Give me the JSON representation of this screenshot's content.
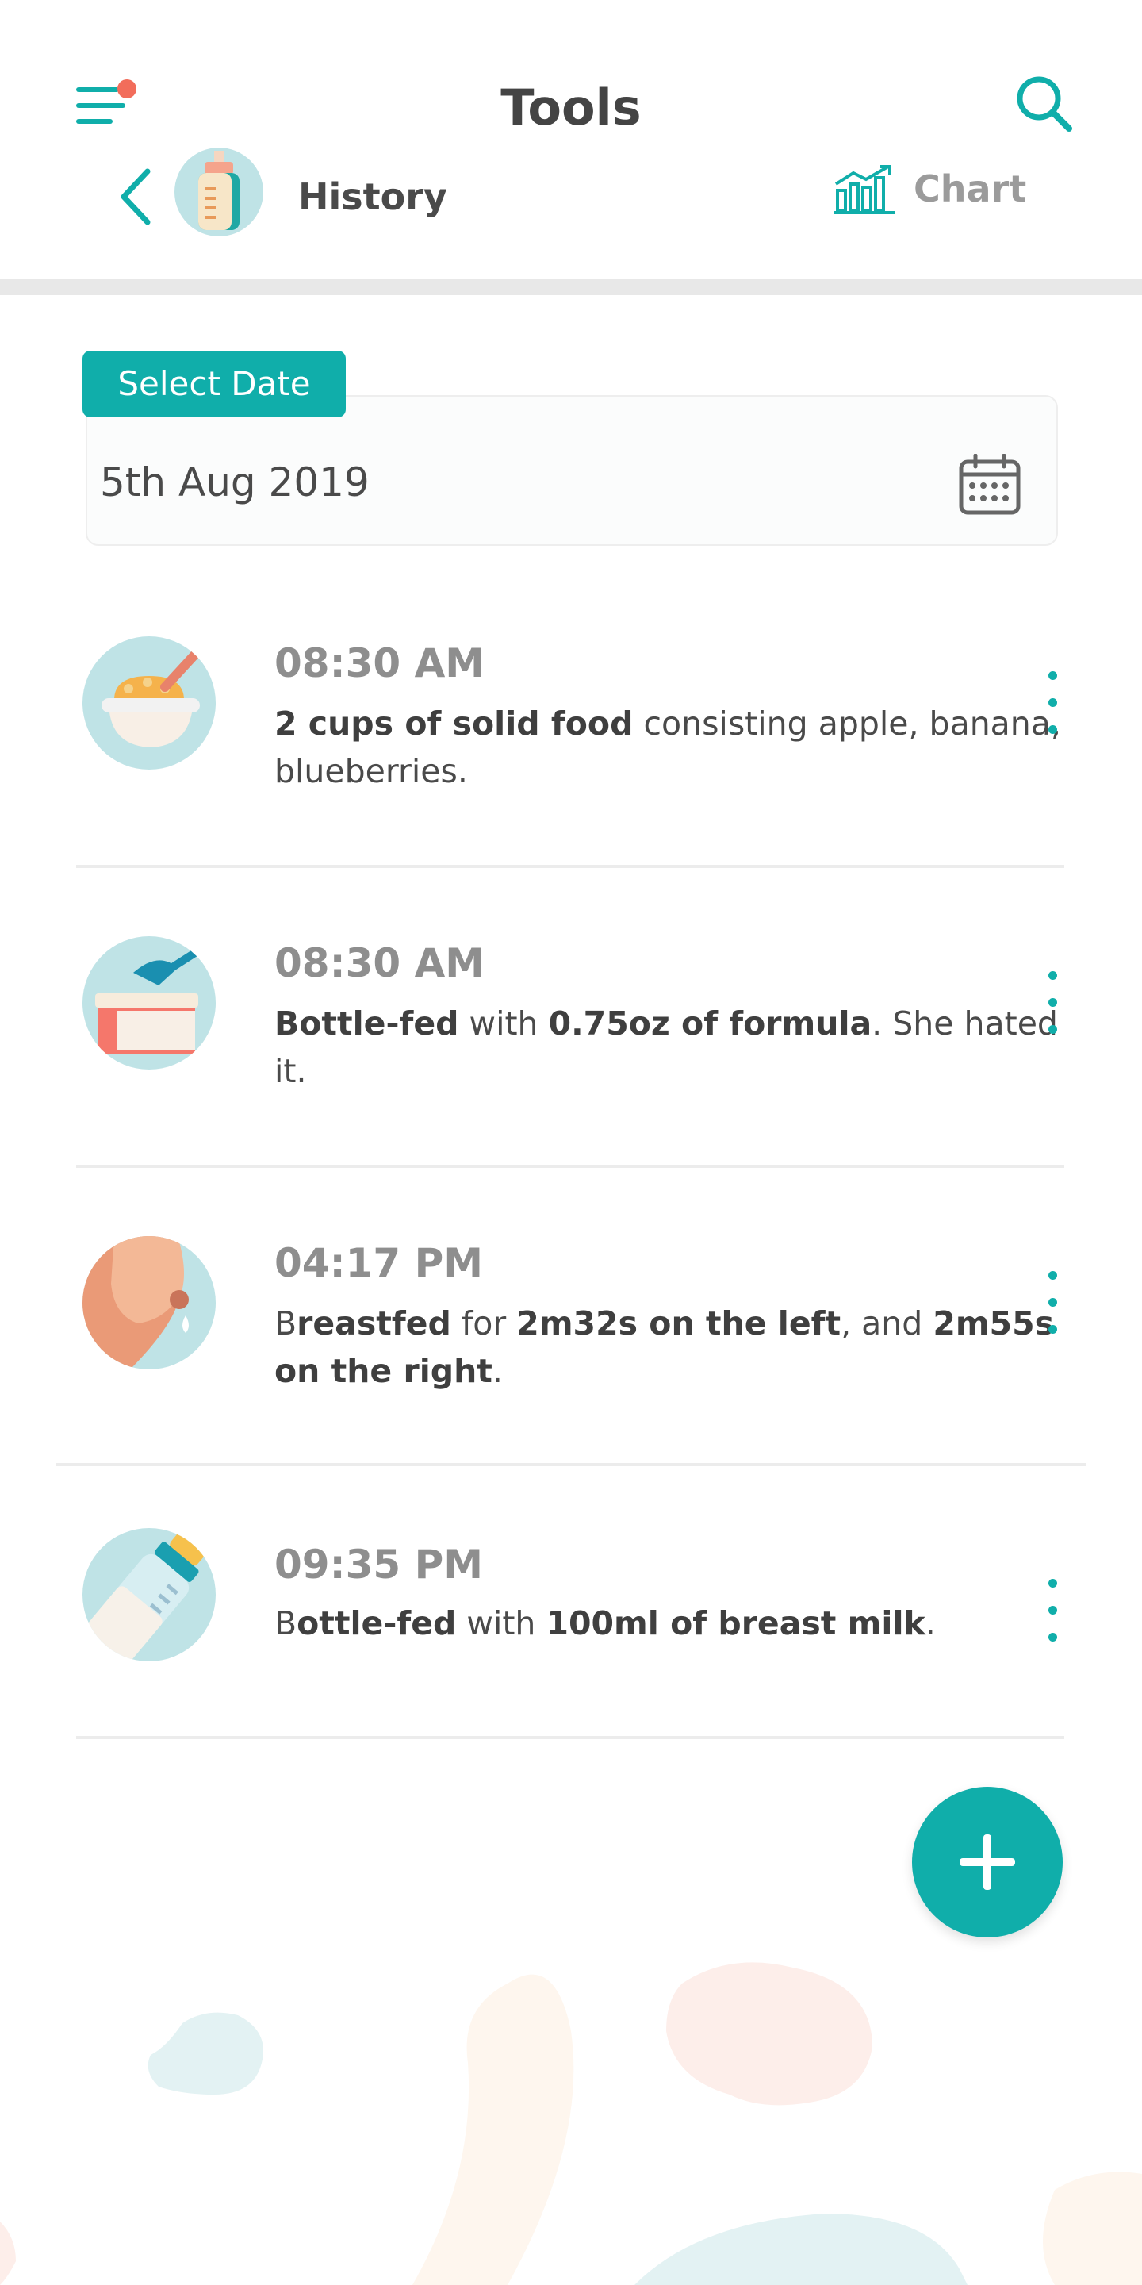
{
  "header": {
    "title": "Tools",
    "subtitle": "History",
    "chart_label": "Chart",
    "menu_has_notification": true,
    "icons": [
      "menu-icon",
      "search-icon",
      "back-icon",
      "bottle-icon",
      "chart-icon"
    ]
  },
  "date_picker": {
    "label": "Select Date",
    "value": "5th Aug 2019",
    "icon": "calendar-icon"
  },
  "feeds": [
    {
      "time": "08:30 AM",
      "icon": "solid-food-icon",
      "parts": [
        {
          "text": "2 cups of solid food",
          "bold": true
        },
        {
          "text": " consisting apple, banana, blueberries.",
          "bold": false
        }
      ]
    },
    {
      "time": "08:30 AM",
      "icon": "formula-icon",
      "parts": [
        {
          "text": "Bottle-fed",
          "bold": true
        },
        {
          "text": " with ",
          "bold": false
        },
        {
          "text": "0.75oz of formula",
          "bold": true
        },
        {
          "text": ". She hated it.",
          "bold": false
        }
      ]
    },
    {
      "time": "04:17 PM",
      "icon": "breastfeed-icon",
      "parts": [
        {
          "text": "B",
          "bold": false
        },
        {
          "text": "reastfed",
          "bold": true
        },
        {
          "text": " for ",
          "bold": false
        },
        {
          "text": "2m32s on the left",
          "bold": true
        },
        {
          "text": ", and ",
          "bold": false
        },
        {
          "text": "2m55s on the right",
          "bold": true
        },
        {
          "text": ".",
          "bold": false
        }
      ]
    },
    {
      "time": "09:35 PM",
      "icon": "breast-milk-bottle-icon",
      "parts": [
        {
          "text": "B",
          "bold": false
        },
        {
          "text": "ottle-fed",
          "bold": true
        },
        {
          "text": " with ",
          "bold": false
        },
        {
          "text": "100ml of breast milk",
          "bold": true
        },
        {
          "text": ".",
          "bold": false
        }
      ]
    }
  ],
  "fab": {
    "icon": "plus-icon"
  },
  "colors": {
    "accent": "#10aeaa",
    "notification": "#f26d5b",
    "icon_bg": "#bfe3e6",
    "muted_text": "#8e8e8e"
  }
}
